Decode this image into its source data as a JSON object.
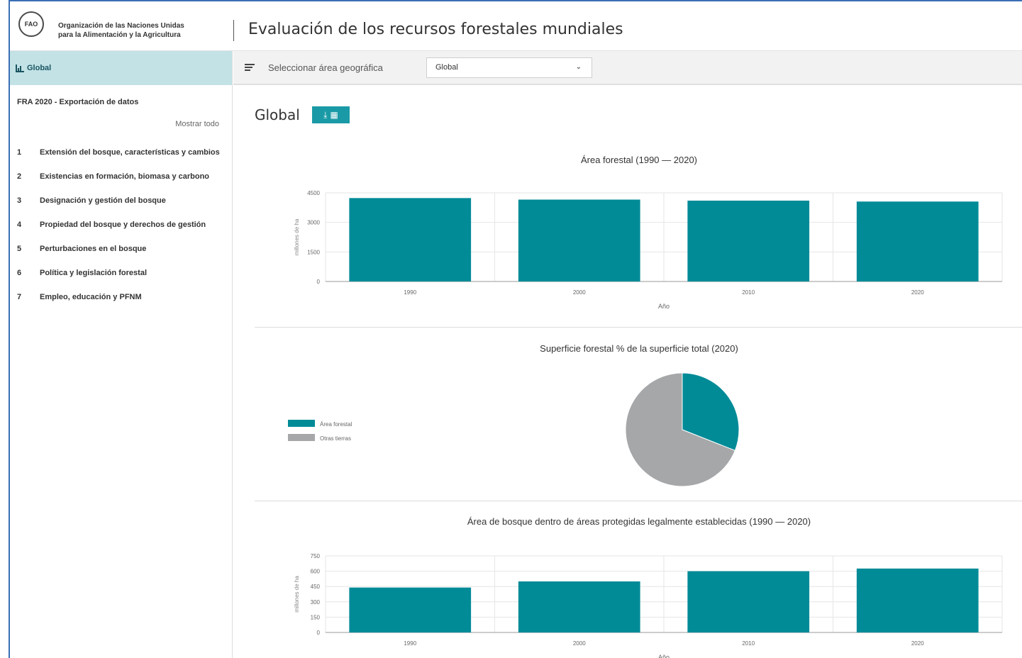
{
  "org": {
    "logo_text": "FAO",
    "line1": "Organización de las Naciones Unidas",
    "line2": "para la Alimentación y la Agricultura"
  },
  "app_title": "Evaluación de los recursos forestales mundiales",
  "sidebar": {
    "header_label": "Global",
    "title": "FRA 2020 - Exportación de datos",
    "show_all": "Mostrar todo",
    "items": [
      {
        "num": "1",
        "label": "Extensión del bosque, características y cambios"
      },
      {
        "num": "2",
        "label": "Existencias en formación, biomasa y carbono"
      },
      {
        "num": "3",
        "label": "Designación y gestión del bosque"
      },
      {
        "num": "4",
        "label": "Propiedad del bosque y derechos de gestión"
      },
      {
        "num": "5",
        "label": "Perturbaciones en el bosque"
      },
      {
        "num": "6",
        "label": "Política y legislación forestal"
      },
      {
        "num": "7",
        "label": "Empleo, educación y PFNM"
      }
    ]
  },
  "toolbar": {
    "label": "Seleccionar área geográfica",
    "selected": "Global"
  },
  "main": {
    "title": "Global"
  },
  "colors": {
    "teal": "#008b97",
    "grey": "#a5a7a9",
    "accent": "#1a9aa6"
  },
  "chart_data": [
    {
      "type": "bar",
      "title": "Área forestal (1990 — 2020)",
      "xlabel": "Año",
      "ylabel": "millones de ha",
      "categories": [
        "1990",
        "2000",
        "2010",
        "2020"
      ],
      "values": [
        4236,
        4158,
        4106,
        4059
      ],
      "ylim": [
        0,
        4500
      ],
      "yticks": [
        0,
        1500,
        3000,
        4500
      ],
      "grid": true
    },
    {
      "type": "pie",
      "title": "Superficie forestal % de la superficie total (2020)",
      "labels": [
        "Área forestal",
        "Otras tierras"
      ],
      "values": [
        31,
        69
      ],
      "legend": "left"
    },
    {
      "type": "bar",
      "title": "Área de bosque dentro de áreas protegidas legalmente establecidas (1990 — 2020)",
      "xlabel": "Año",
      "ylabel": "millones de ha",
      "categories": [
        "1990",
        "2000",
        "2010",
        "2020"
      ],
      "values": [
        440,
        500,
        600,
        626
      ],
      "ylim": [
        0,
        750
      ],
      "yticks": [
        0,
        150,
        300,
        450,
        600,
        750
      ],
      "grid": true
    }
  ]
}
